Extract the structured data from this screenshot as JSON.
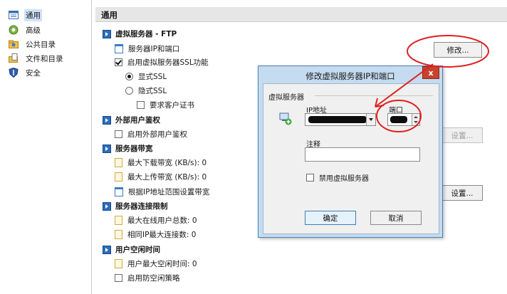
{
  "nav": {
    "items": [
      {
        "label": "通用",
        "icon": "general-settings-icon",
        "selected": true
      },
      {
        "label": "高级",
        "icon": "gear-icon",
        "selected": false
      },
      {
        "label": "公共目录",
        "icon": "public-folder-icon",
        "selected": false
      },
      {
        "label": "文件和目录",
        "icon": "file-folder-icon",
        "selected": false
      },
      {
        "label": "安全",
        "icon": "shield-icon",
        "selected": false
      }
    ]
  },
  "header": {
    "title": "通用"
  },
  "sections": {
    "ftp": {
      "title": "虚拟服务器 - FTP",
      "ip_port": "服务器IP和端口",
      "ssl": "启用虚拟服务器SSL功能",
      "explicit": "显式SSL",
      "implicit": "隐式SSL",
      "client_cert": "要求客户证书"
    },
    "ext_auth": {
      "title": "外部用户鉴权",
      "enable": "启用外部用户鉴权"
    },
    "bandwidth": {
      "title": "服务器带宽",
      "download": "最大下载带宽 (KB/s): 0",
      "upload": "最大上传带宽 (KB/s): 0",
      "by_ip": "根据IP地址范围设置带宽"
    },
    "conn": {
      "title": "服务器连接限制",
      "max_online": "最大在线用户总数: 0",
      "same_ip": "相同IP最大连接数: 0"
    },
    "idle": {
      "title": "用户空闲时间",
      "max_idle": "用户最大空闲时间: 0",
      "anti_idle": "启用防空闲策略"
    }
  },
  "buttons": {
    "modify": "修改...",
    "settings1": "设置...",
    "settings2": "设置..."
  },
  "dialog": {
    "title": "修改虚拟服务器IP和端口",
    "close": "x",
    "group": "虚拟服务器",
    "ip_label": "IP地址",
    "port_label": "端口",
    "note_label": "注释",
    "note_value": "",
    "disable": "禁用虚拟服务器",
    "ok": "确定",
    "cancel": "取消"
  },
  "colors": {
    "annotation": "#e02020",
    "section_icon": "#2a6ebe"
  }
}
